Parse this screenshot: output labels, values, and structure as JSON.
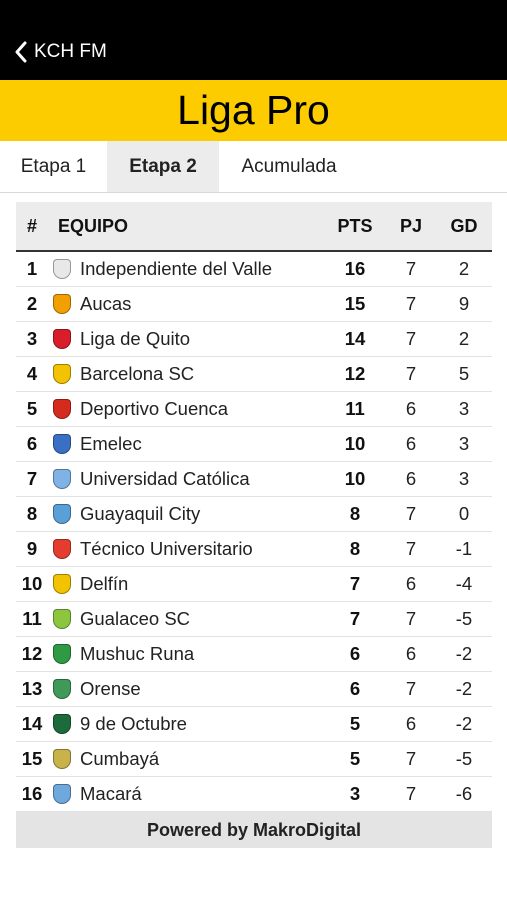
{
  "header": {
    "back_label": "KCH FM"
  },
  "banner": {
    "title": "Liga Pro"
  },
  "tabs": [
    {
      "label": "Etapa 1",
      "active": false
    },
    {
      "label": "Etapa 2",
      "active": true
    },
    {
      "label": "Acumulada",
      "active": false
    }
  ],
  "table": {
    "headers": {
      "pos": "#",
      "team": "EQUIPO",
      "pts": "PTS",
      "pj": "PJ",
      "gd": "GD"
    },
    "rows": [
      {
        "pos": "1",
        "team": "Independiente del Valle",
        "pts": "16",
        "pj": "7",
        "gd": "2",
        "crest_color": "#e8e8e8",
        "crest_icon": "independiente-del-valle-crest-icon"
      },
      {
        "pos": "2",
        "team": "Aucas",
        "pts": "15",
        "pj": "7",
        "gd": "9",
        "crest_color": "#f2a000",
        "crest_icon": "aucas-crest-icon"
      },
      {
        "pos": "3",
        "team": "Liga de Quito",
        "pts": "14",
        "pj": "7",
        "gd": "2",
        "crest_color": "#d81e2a",
        "crest_icon": "liga-de-quito-crest-icon"
      },
      {
        "pos": "4",
        "team": "Barcelona SC",
        "pts": "12",
        "pj": "7",
        "gd": "5",
        "crest_color": "#f3c200",
        "crest_icon": "barcelona-sc-crest-icon"
      },
      {
        "pos": "5",
        "team": "Deportivo Cuenca",
        "pts": "11",
        "pj": "6",
        "gd": "3",
        "crest_color": "#d42b1e",
        "crest_icon": "deportivo-cuenca-crest-icon"
      },
      {
        "pos": "6",
        "team": "Emelec",
        "pts": "10",
        "pj": "6",
        "gd": "3",
        "crest_color": "#3a70c4",
        "crest_icon": "emelec-crest-icon"
      },
      {
        "pos": "7",
        "team": "Universidad Católica",
        "pts": "10",
        "pj": "6",
        "gd": "3",
        "crest_color": "#7fb3e6",
        "crest_icon": "universidad-catolica-crest-icon"
      },
      {
        "pos": "8",
        "team": "Guayaquil City",
        "pts": "8",
        "pj": "7",
        "gd": "0",
        "crest_color": "#5aa0d8",
        "crest_icon": "guayaquil-city-crest-icon"
      },
      {
        "pos": "9",
        "team": "Técnico Universitario",
        "pts": "8",
        "pj": "7",
        "gd": "-1",
        "crest_color": "#e43d30",
        "crest_icon": "tecnico-universitario-crest-icon"
      },
      {
        "pos": "10",
        "team": "Delfín",
        "pts": "7",
        "pj": "6",
        "gd": "-4",
        "crest_color": "#f2c300",
        "crest_icon": "delfin-crest-icon"
      },
      {
        "pos": "11",
        "team": "Gualaceo SC",
        "pts": "7",
        "pj": "7",
        "gd": "-5",
        "crest_color": "#8cc63f",
        "crest_icon": "gualaceo-sc-crest-icon"
      },
      {
        "pos": "12",
        "team": "Mushuc Runa",
        "pts": "6",
        "pj": "6",
        "gd": "-2",
        "crest_color": "#2e9a44",
        "crest_icon": "mushuc-runa-crest-icon"
      },
      {
        "pos": "13",
        "team": "Orense",
        "pts": "6",
        "pj": "7",
        "gd": "-2",
        "crest_color": "#3f9a5a",
        "crest_icon": "orense-crest-icon"
      },
      {
        "pos": "14",
        "team": "9 de Octubre",
        "pts": "5",
        "pj": "6",
        "gd": "-2",
        "crest_color": "#1d6b3a",
        "crest_icon": "9-de-octubre-crest-icon"
      },
      {
        "pos": "15",
        "team": "Cumbayá",
        "pts": "5",
        "pj": "7",
        "gd": "-5",
        "crest_color": "#c9b24a",
        "crest_icon": "cumbaya-crest-icon"
      },
      {
        "pos": "16",
        "team": "Macará",
        "pts": "3",
        "pj": "7",
        "gd": "-6",
        "crest_color": "#6fa8dc",
        "crest_icon": "macara-crest-icon"
      }
    ]
  },
  "footer": {
    "text": "Powered by MakroDigital"
  },
  "colors": {
    "topbar": "#000000",
    "banner": "#fccc00",
    "active_tab": "#ececec",
    "header_row": "#ececec",
    "footer": "#e4e4e4"
  }
}
